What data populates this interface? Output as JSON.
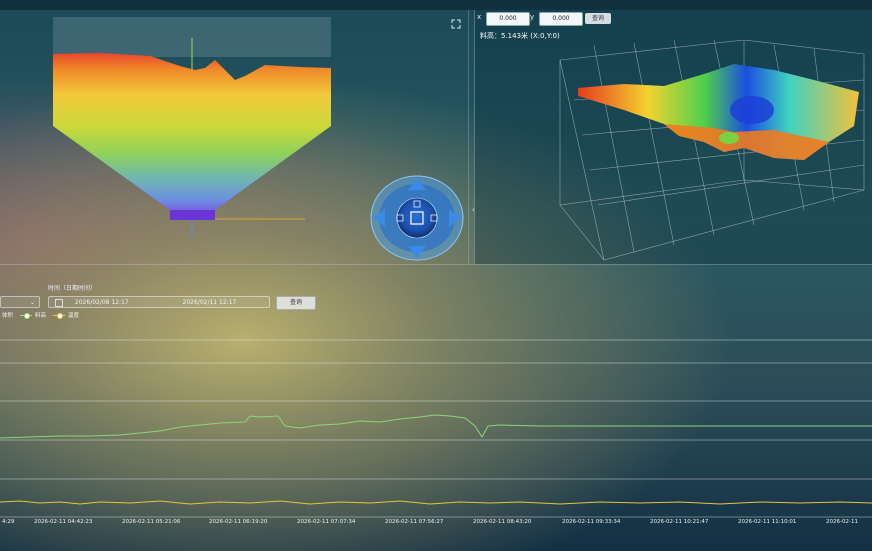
{
  "toolbar": {
    "x_label": "x",
    "x_value": "0.000",
    "y_label": "y",
    "y_value": "0.000",
    "query_label": "查询"
  },
  "readout": "料高：5.143米 (X:0,Y:0)",
  "time_filter": {
    "label": "时间（日期时间）",
    "start": "2026/02/08 12:17",
    "end": "2026/02/11 12:17",
    "query_label": "查询"
  },
  "legend": {
    "items": [
      {
        "label": "体积",
        "color": "#cfe6ff"
      },
      {
        "label": "料高",
        "color": "#9ee07a"
      },
      {
        "label": "温度",
        "color": "#f0c040"
      }
    ]
  },
  "x_ticks": [
    "4:29",
    "2026-02-11 04:42:23",
    "2026-02-11 05:21:06",
    "2026-02-11 06:19:20",
    "2026-02-11 07:07:34",
    "2026-02-11 07:56:27",
    "2026-02-11 08:43:20",
    "2026-02-11 09:33:34",
    "2026-02-11 10:21:47",
    "2026-02-11 11:10:01",
    "2026-02-11"
  ],
  "icons": {
    "expand": "expand-icon",
    "control": "view-control-icon",
    "calendar": "calendar-icon"
  },
  "colors": {
    "line_green": "#8fd37a",
    "line_yellow": "#e6c53a",
    "accent_blue": "#2c7be0"
  }
}
